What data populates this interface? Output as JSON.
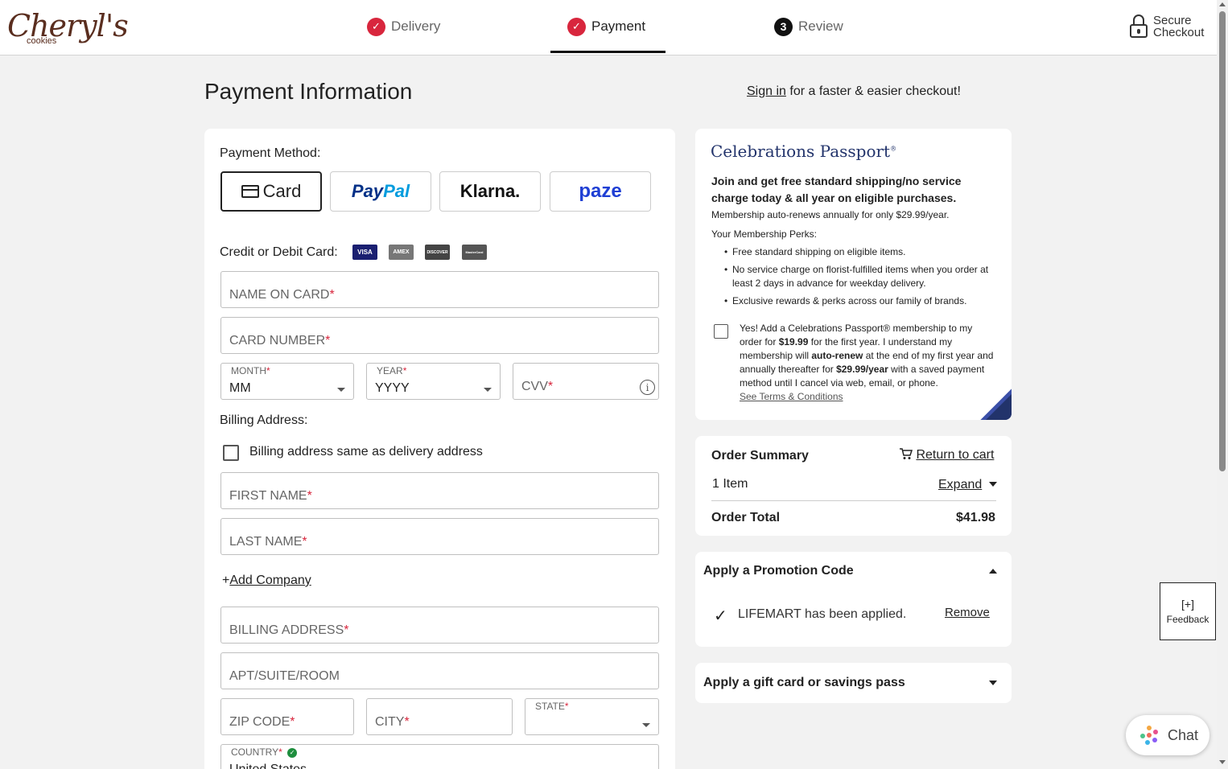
{
  "brand": {
    "logo_text": "Cheryl's",
    "logo_subtext": "cookies"
  },
  "steps": [
    {
      "label": "Delivery",
      "state": "complete"
    },
    {
      "label": "Payment",
      "state": "active"
    },
    {
      "label": "Review",
      "number": "3",
      "state": "pending"
    }
  ],
  "secure_checkout": {
    "line1": "Secure",
    "line2": "Checkout"
  },
  "page": {
    "title": "Payment Information",
    "signin_link": "Sign in",
    "signin_rest": " for a faster & easier checkout!"
  },
  "payment": {
    "method_label": "Payment Method:",
    "methods": {
      "card": "Card",
      "paypal_a": "Pay",
      "paypal_b": "Pal",
      "klarna": "Klarna.",
      "paze": "paze"
    },
    "card_label": "Credit or Debit Card:",
    "card_logos": [
      "VISA",
      "AMEX",
      "DISCOVER",
      "MasterCard"
    ],
    "name_on_card": "NAME ON CARD",
    "card_number": "CARD NUMBER",
    "month_label": "MONTH",
    "month_value": "MM",
    "year_label": "YEAR",
    "year_value": "YYYY",
    "cvv": "CVV",
    "required_mark": "*",
    "info_glyph": "i"
  },
  "billing": {
    "label": "Billing Address:",
    "same_as_delivery": "Billing address same as delivery address",
    "first_name": "FIRST NAME",
    "last_name": "LAST NAME",
    "add_company_plus": "+",
    "add_company": "Add Company",
    "address": "BILLING ADDRESS",
    "apt": "APT/SUITE/ROOM",
    "zip": "ZIP CODE",
    "city": "CITY",
    "state_label": "STATE",
    "country_label": "COUNTRY",
    "country_value": "United States"
  },
  "passport": {
    "title": "Celebrations Passport",
    "title_mark": "®",
    "intro_bold": "Join and get free standard shipping/no service charge today & all year on eligible purchases.",
    "intro_rest": " Membership auto-renews annually for only $29.99/year.",
    "perks_label": "Your Membership Perks:",
    "perks": [
      "Free standard shipping on eligible items.",
      "No service charge on florist-fulfilled items when you order at least 2 days in advance for weekday delivery.",
      "Exclusive rewards & perks across our family of brands."
    ],
    "optin_a": "Yes! Add a Celebrations Passport® membership to my order for ",
    "optin_price1": "$19.99",
    "optin_b": " for the first year. I understand my membership will ",
    "optin_autorenew": "auto-renew",
    "optin_c": " at the end of my first year and annually thereafter for ",
    "optin_price2": "$29.99/year",
    "optin_d": " with a saved payment method until I cancel via web, email, or phone.",
    "terms_link": "See Terms & Conditions",
    "accent_color": "#22336b"
  },
  "summary": {
    "title": "Order Summary",
    "return_link": "Return to cart",
    "items": "1 Item",
    "expand_link": "Expand",
    "total_label": "Order Total",
    "total_value": "$41.98"
  },
  "promo": {
    "title": "Apply a Promotion Code",
    "check_glyph": "✓",
    "applied_text": "LIFEMART has been applied.",
    "remove_link": "Remove"
  },
  "giftcard": {
    "title": "Apply a gift card or savings pass"
  },
  "feedback": {
    "icon": "[+]",
    "label": "Feedback"
  },
  "chat": {
    "label": "Chat"
  },
  "colors": {
    "brand_red": "#d8263d",
    "paypal_dark": "#003087",
    "paypal_light": "#009cde",
    "paze_blue": "#1f3fd4",
    "success_green": "#1e8e3e"
  }
}
